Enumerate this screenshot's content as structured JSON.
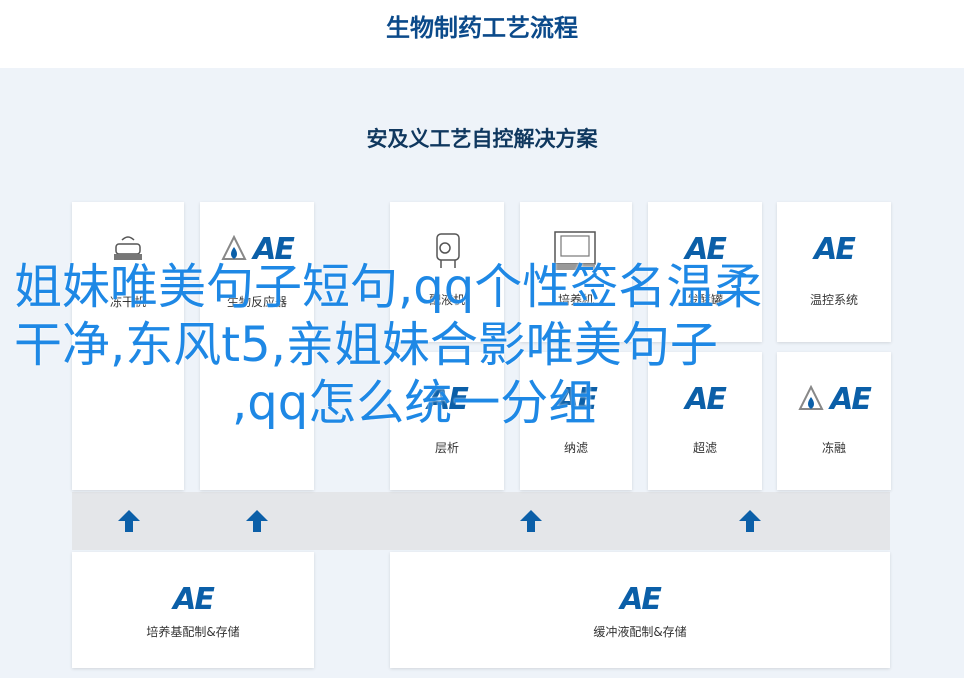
{
  "header": {
    "title": "生物制药工艺流程"
  },
  "panel": {
    "title": "安及义工艺自控解决方案"
  },
  "colors": {
    "accent": "#0b5fa8",
    "title": "#0b4a8a",
    "overlay": "#1e88e5",
    "background": "#eef3f9"
  },
  "top_row": [
    {
      "label": "冻干机",
      "icon": "freeze-dryer-icon",
      "text_sub": ""
    },
    {
      "label": "生物反应器",
      "icon": "ae-logo-icon"
    },
    {
      "label": "配液机",
      "icon": "mixer-machine-icon"
    },
    {
      "label": "培养机",
      "icon": "cabinet-machine-icon"
    },
    {
      "label": "发酵罐",
      "icon": "ae-logo-icon"
    },
    {
      "label": "温控系统",
      "icon": "ae-logo-icon"
    }
  ],
  "mid_row": [
    {
      "label": "层析",
      "icon": "ae-logo-icon"
    },
    {
      "label": "纳滤",
      "icon": "ae-logo-icon"
    },
    {
      "label": "超滤",
      "icon": "ae-logo-icon"
    },
    {
      "label": "冻融",
      "icon": "ae-logo-icon"
    }
  ],
  "bottom_row": [
    {
      "label": "培养基配制&存储",
      "icon": "ae-logo-icon"
    },
    {
      "label": "缓冲液配制&存储",
      "icon": "ae-logo-icon"
    }
  ],
  "logo": {
    "text": "AE",
    "mark": "®"
  },
  "overlay": {
    "line1": "姐妹唯美句子短句,qq个性签名温柔",
    "line2": "干净,东风t5,亲姐妹合影唯美句子",
    "line3": ",qq怎么统一分组"
  }
}
